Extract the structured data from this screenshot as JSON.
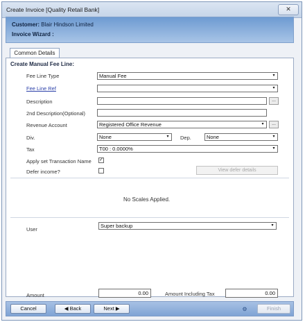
{
  "window": {
    "title": "Create Invoice [Quality Retail Bank]",
    "close_glyph": "✕"
  },
  "header": {
    "customer_label": "Customer:",
    "customer_name": "Blair Hindson Limited",
    "wizard_label": "Invoice Wizard :"
  },
  "tabs": [
    {
      "label": "Common Details",
      "selected": true
    }
  ],
  "form": {
    "section_title": "Create Manual Fee Line:",
    "fee_line_type": {
      "label": "Fee Line Type",
      "value": "Manual Fee"
    },
    "fee_line_ref": {
      "label": "Fee Line Ref",
      "value": ""
    },
    "description": {
      "label": "Description",
      "value": "",
      "button": "..."
    },
    "description2": {
      "label": "2nd Description(Optional)",
      "value": ""
    },
    "revenue_account": {
      "label": "Revenue Account",
      "value": "Registered Office Revenue",
      "button": "..."
    },
    "div": {
      "label": "Div.",
      "value": "None"
    },
    "dep": {
      "label": "Dep.",
      "value": "None"
    },
    "tax": {
      "label": "Tax",
      "value": "T00 : 0.0000%"
    },
    "apply_transaction_name": {
      "label": "Apply set Transaction Name",
      "checked": true,
      "mark": "✓"
    },
    "defer_income": {
      "label": "Defer income?",
      "checked": false
    },
    "view_defer_details": "View defer details",
    "scales_message": "No Scales Applied.",
    "user": {
      "label": "User",
      "value": "Super backup"
    },
    "amount": {
      "label": "Amount",
      "value": "0.00"
    },
    "amount_incl_tax": {
      "label": "Amount Including Tax",
      "value": "0.00"
    },
    "dropdown_glyph": "▾"
  },
  "footer": {
    "cancel": "Cancel",
    "back": "◀ Back",
    "next": "Next ▶",
    "help_glyph": "⚙",
    "finish": "Finish"
  },
  "colors": {
    "header_band": "#6e9bd2",
    "footer_band": "#7fa3d4",
    "link": "#2a3fa8"
  }
}
